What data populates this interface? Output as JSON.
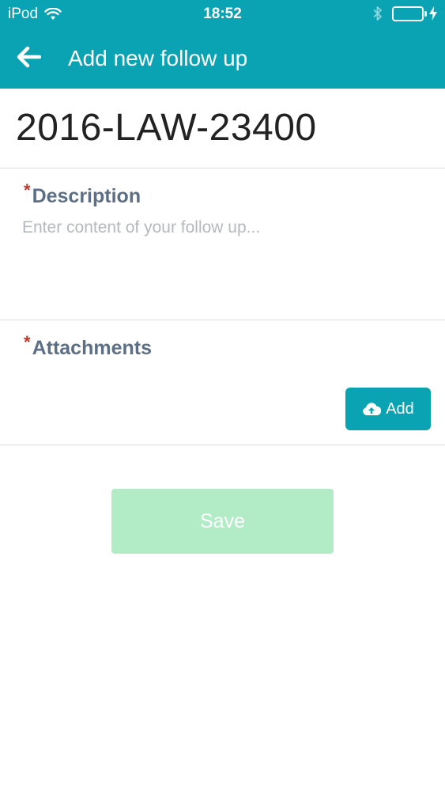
{
  "status_bar": {
    "carrier": "iPod",
    "time": "18:52",
    "icons": [
      "wifi-icon",
      "bluetooth-icon",
      "battery-icon",
      "charging-bolt-icon"
    ],
    "battery_color": "#4cd964"
  },
  "header": {
    "title": "Add new follow up",
    "back_icon": "arrow-left-icon",
    "background_color": "#0aa3b3"
  },
  "case": {
    "id": "2016-LAW-23400"
  },
  "description": {
    "required_marker": "*",
    "label": "Description",
    "placeholder": "Enter content of your follow up...",
    "value": ""
  },
  "attachments": {
    "required_marker": "*",
    "label": "Attachments",
    "add_label": "Add",
    "add_icon": "cloud-upload-icon"
  },
  "actions": {
    "save_label": "Save",
    "save_color": "#b2ecc6"
  }
}
